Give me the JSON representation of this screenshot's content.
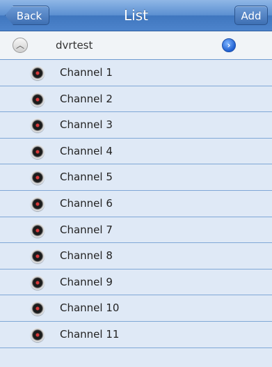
{
  "navbar": {
    "title": "List",
    "back_label": "Back",
    "add_label": "Add"
  },
  "device": {
    "name": "dvrtest",
    "expand_icon": "chevron-up-icon",
    "detail_icon": "detail-disclosure-icon"
  },
  "channels": [
    {
      "label": "Channel 1"
    },
    {
      "label": "Channel 2"
    },
    {
      "label": "Channel 3"
    },
    {
      "label": "Channel 4"
    },
    {
      "label": "Channel 5"
    },
    {
      "label": "Channel 6"
    },
    {
      "label": "Channel 7"
    },
    {
      "label": "Channel 8"
    },
    {
      "label": "Channel 9"
    },
    {
      "label": "Channel 10"
    },
    {
      "label": "Channel 11"
    }
  ],
  "colors": {
    "navbar": "#4d84cc",
    "row_background": "#dfe9f6",
    "separator": "#7fa7d6"
  }
}
